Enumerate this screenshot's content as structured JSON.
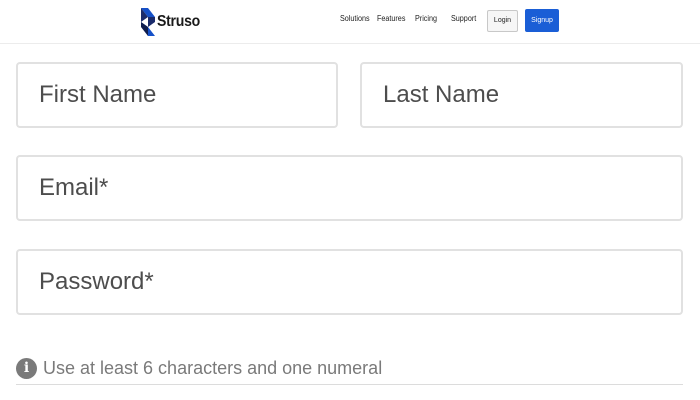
{
  "header": {
    "brand": "Struso",
    "nav": [
      "Solutions",
      "Features",
      "Pricing",
      "Support"
    ],
    "login_label": "Login",
    "signup_label": "Signup",
    "accent_color": "#1a5ed6"
  },
  "form": {
    "first_name_placeholder": "First Name",
    "last_name_placeholder": "Last Name",
    "email_placeholder": "Email*",
    "password_placeholder": "Password*",
    "password_hint": "Use at least 6 characters and one numeral",
    "hint_icon": "info-icon"
  }
}
